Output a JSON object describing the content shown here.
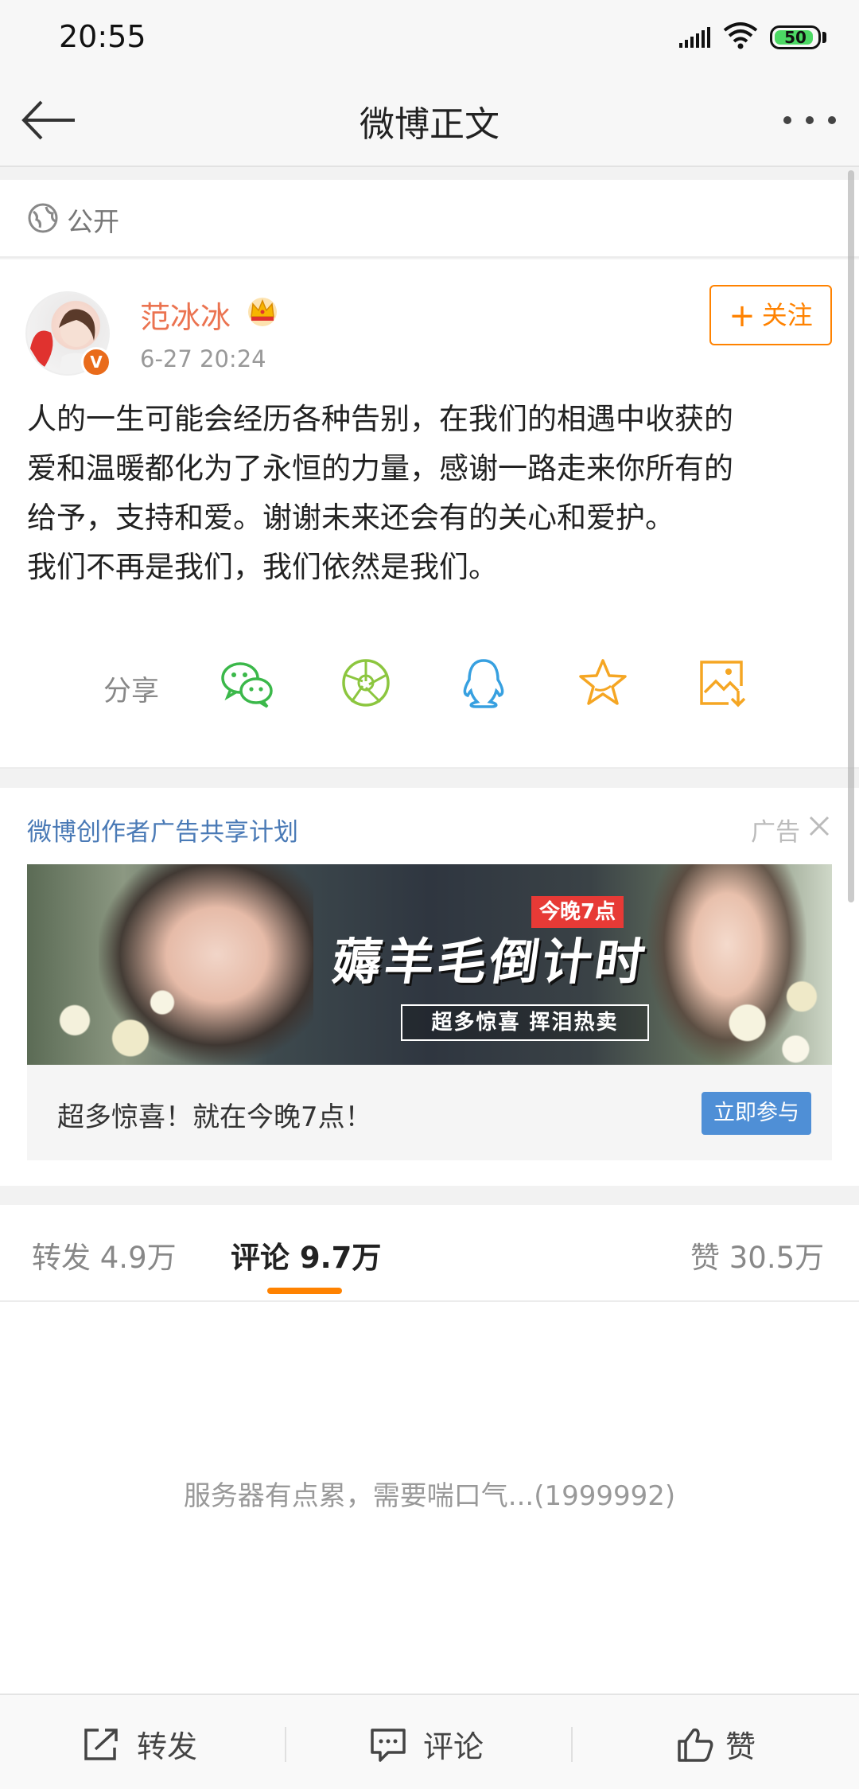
{
  "status_bar": {
    "time": "20:55",
    "battery": "50"
  },
  "nav": {
    "title": "微博正文"
  },
  "visibility": {
    "label": "公开"
  },
  "post": {
    "username": "范冰冰",
    "time": "6-27 20:24",
    "follow_label": "关注",
    "follow_plus": "+",
    "body_lines": [
      "人的一生可能会经历各种告别，在我们的相遇中收获的",
      "爱和温暖都化为了永恒的力量，感谢一路走来你所有的",
      "给予，支持和爱。谢谢未来还会有的关心和爱护。",
      "我们不再是我们，我们依然是我们。"
    ],
    "verified_badge": "V"
  },
  "share": {
    "label": "分享",
    "icons": [
      "wechat-icon",
      "moments-icon",
      "qq-icon",
      "favorite-icon",
      "save-image-icon"
    ],
    "colors": {
      "wechat": "#3bb84a",
      "moments": "#8cc63f",
      "qq": "#37a0e0",
      "favorite": "#f5a623",
      "save": "#f5a623"
    }
  },
  "ad": {
    "title": "微博创作者广告共享计划",
    "tag": "广告",
    "badge": "今晚7点",
    "headline": "薅羊毛倒计时",
    "sub": "超多惊喜  挥泪热卖",
    "footer_text": "超多惊喜！就在今晚7点！",
    "button": "立即参与"
  },
  "tabs": {
    "repost": "转发 4.9万",
    "comments": "评论 9.7万",
    "likes": "赞 30.5万"
  },
  "comments": {
    "error": "服务器有点累，需要喘口气...(1999992)"
  },
  "toolbar": {
    "repost": "转发",
    "comment": "评论",
    "like": "赞"
  },
  "colors": {
    "accent": "#ff8200",
    "username": "#eb7350",
    "link": "#4a7ab6"
  }
}
